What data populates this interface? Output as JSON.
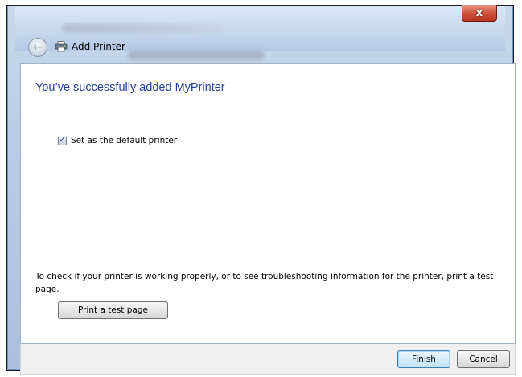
{
  "window": {
    "title": "Add Printer",
    "close_label": "x"
  },
  "content": {
    "heading": "You’ve successfully added MyPrinter",
    "default_printer_checkbox": {
      "label": "Set as the default printer",
      "checked": true
    },
    "info_text": "To check if your printer is working properly, or to see troubleshooting information for the printer, print a test page.",
    "test_page_button": "Print a test page"
  },
  "footer": {
    "finish_label": "Finish",
    "cancel_label": "Cancel"
  },
  "icons": {
    "back": "back-arrow-icon",
    "printer": "printer-icon",
    "checkmark": "checkmark-icon",
    "close": "close-icon"
  },
  "colors": {
    "heading": "#1f3f9a",
    "close_button": "#c8402a",
    "finish_border": "#3c7fb1"
  }
}
